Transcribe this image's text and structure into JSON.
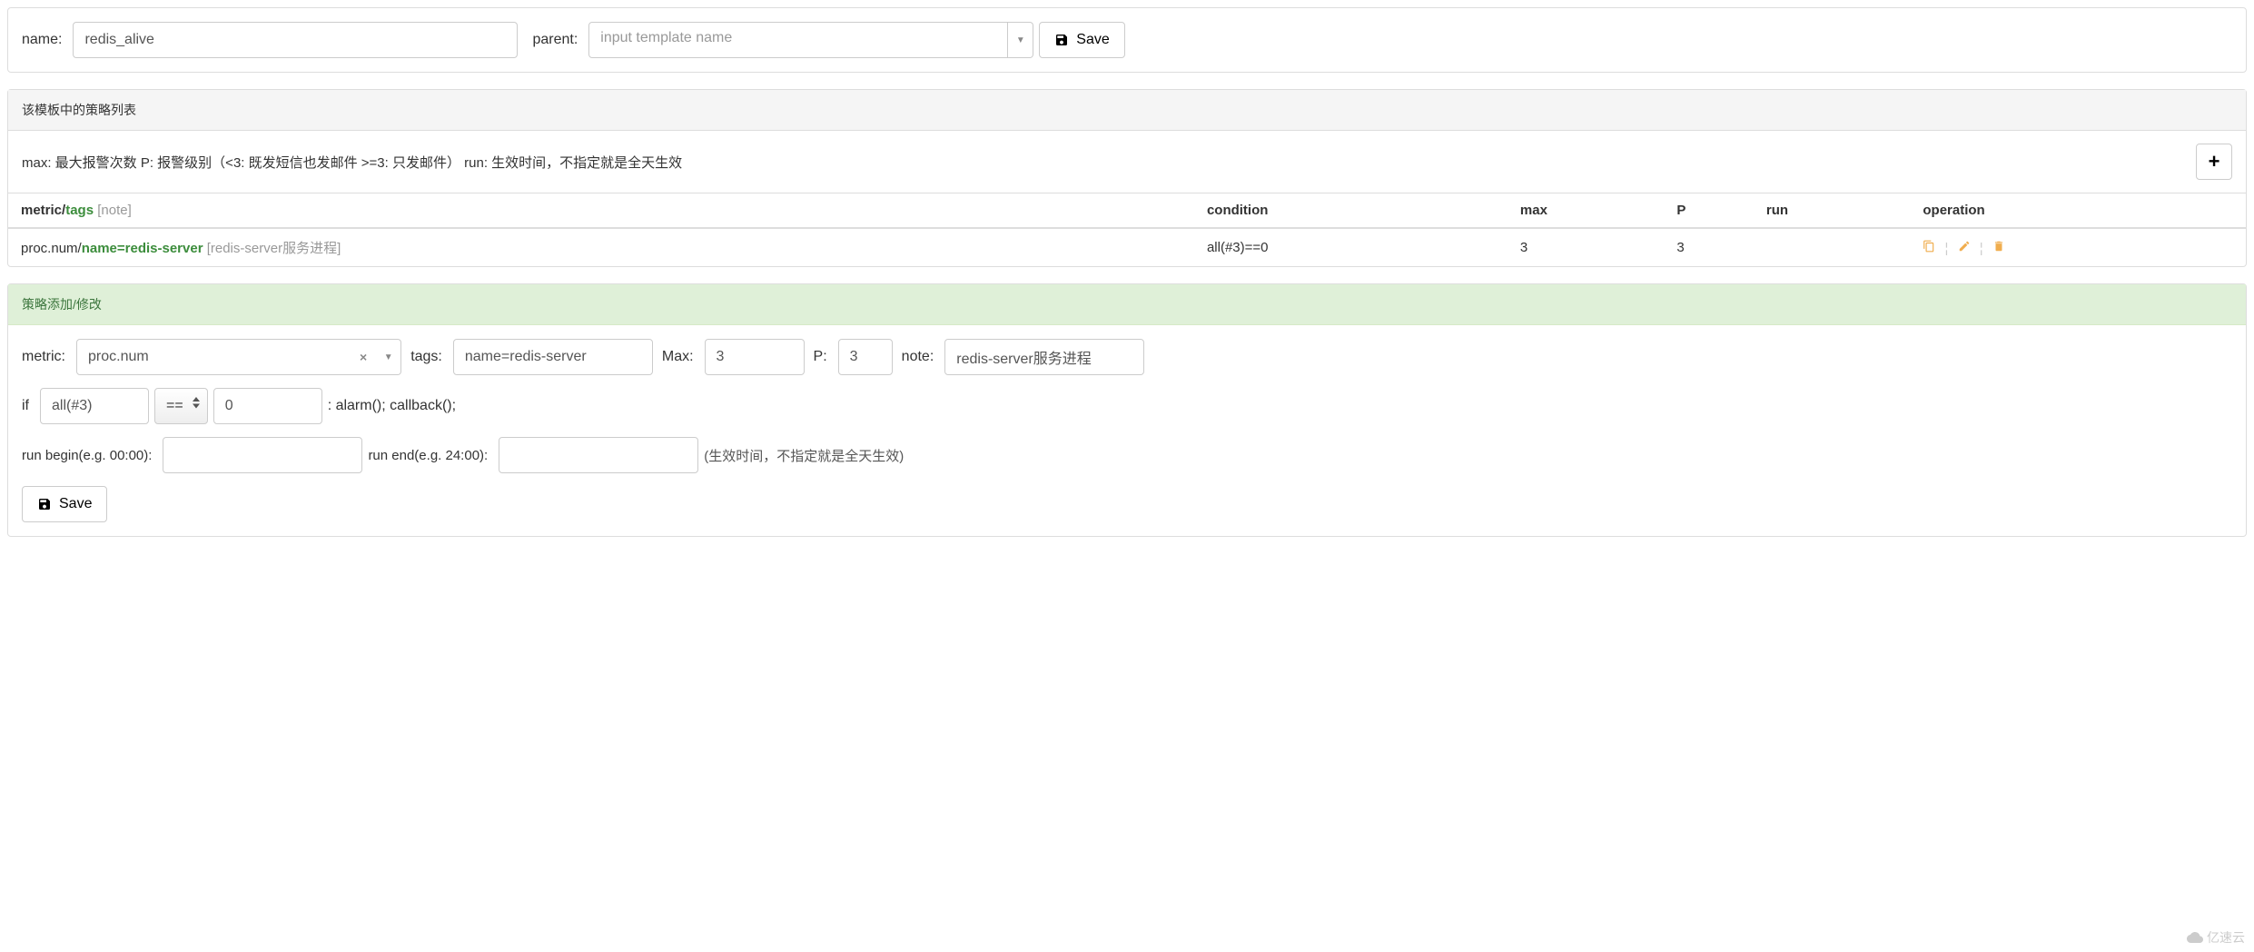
{
  "header": {
    "name_label": "name:",
    "name_value": "redis_alive",
    "parent_label": "parent:",
    "parent_placeholder": "input template name",
    "save_label": "Save"
  },
  "strategy_list": {
    "title": "该模板中的策略列表",
    "description": "max: 最大报警次数 P: 报警级别（<3: 既发短信也发邮件 >=3: 只发邮件） run: 生效时间，不指定就是全天生效",
    "columns": {
      "metric": "metric/",
      "tags": "tags",
      "note": " [note]",
      "condition": "condition",
      "max": "max",
      "p": "P",
      "run": "run",
      "operation": "operation"
    },
    "rows": [
      {
        "metric": "proc.num/",
        "tags": "name=redis-server",
        "note": " [redis-server服务进程]",
        "condition": "all(#3)==0",
        "max": "3",
        "p": "3",
        "run": ""
      }
    ]
  },
  "strategy_form": {
    "title": "策略添加/修改",
    "metric_label": "metric:",
    "metric_value": "proc.num",
    "tags_label": "tags:",
    "tags_value": "name=redis-server",
    "max_label": "Max:",
    "max_value": "3",
    "p_label": "P:",
    "p_value": "3",
    "note_label": "note:",
    "note_value": "redis-server服务进程",
    "if_label": "if",
    "func_value": "all(#3)",
    "op_value": "==",
    "threshold_value": "0",
    "alarm_text": ": alarm(); callback();",
    "run_begin_label": "run begin(e.g. 00:00):",
    "run_begin_value": "",
    "run_end_label": "run end(e.g. 24:00):",
    "run_end_value": "",
    "run_hint": "(生效时间，不指定就是全天生效)",
    "save_label": "Save"
  },
  "watermark": "亿速云"
}
